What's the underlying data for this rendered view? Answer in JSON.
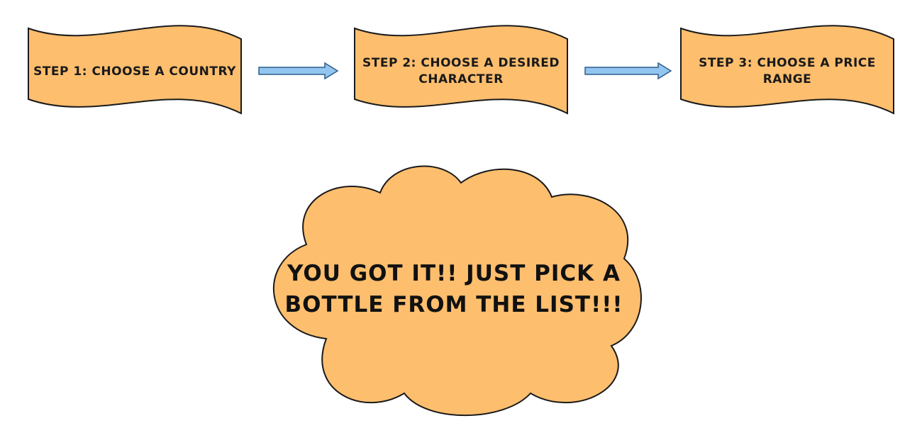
{
  "colors": {
    "shape_fill": "#FDBE6E",
    "shape_stroke": "#1a1a1a",
    "arrow_fill": "#92C5EF",
    "arrow_stroke": "#2F5E8C",
    "text": "#111111"
  },
  "steps": [
    {
      "line1": "STEP 1:  CHOOSE A COUNTRY",
      "line2": ""
    },
    {
      "line1": "STEP 2: CHOOSE A DESIRED",
      "line2": "CHARACTER"
    },
    {
      "line1": "STEP 3: CHOOSE A PRICE",
      "line2": "RANGE"
    }
  ],
  "cloud": {
    "line1": "YOU GOT IT!! JUST PICK A",
    "line2": "BOTTLE FROM THE LIST!!!"
  }
}
